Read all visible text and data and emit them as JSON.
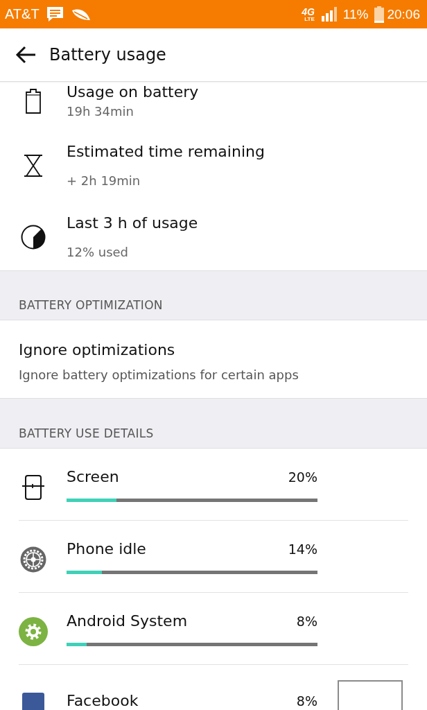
{
  "status_bar": {
    "carrier": "AT&T",
    "network": "4G",
    "network_sub": "LTE",
    "battery": "11%",
    "time": "20:06"
  },
  "toolbar": {
    "title": "Battery usage"
  },
  "summary": [
    {
      "kind": "battery",
      "title": "Usage on battery",
      "subtitle": "19h 34min"
    },
    {
      "kind": "hourglass",
      "title": "Estimated time remaining",
      "subtitle": "+ 2h 19min"
    },
    {
      "kind": "pie",
      "title": "Last 3 h of usage",
      "subtitle": "12% used"
    }
  ],
  "optimization": {
    "header": "BATTERY OPTIMIZATION",
    "items": [
      {
        "title": "Ignore optimizations",
        "subtitle": "Ignore battery optimizations for certain apps"
      }
    ]
  },
  "details": {
    "header": "BATTERY USE DETAILS",
    "apps": [
      {
        "kind": "screen",
        "name": "Screen",
        "percent": "20%",
        "level": 0.2
      },
      {
        "kind": "idle",
        "name": "Phone idle",
        "percent": "14%",
        "level": 0.14
      },
      {
        "kind": "system",
        "name": "Android System",
        "percent": "8%",
        "level": 0.08
      },
      {
        "kind": "app",
        "name": "Facebook",
        "percent": "8%"
      }
    ]
  }
}
